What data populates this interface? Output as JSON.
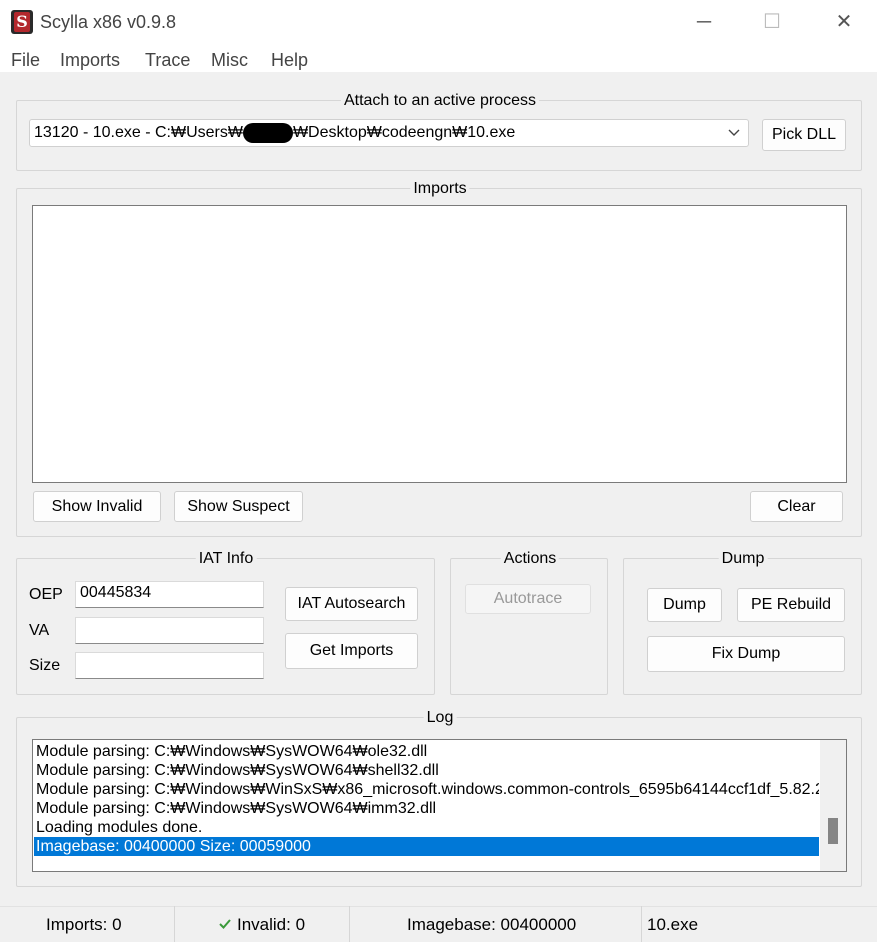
{
  "window": {
    "title": "Scylla x86 v0.9.8",
    "app_icon_letter": "S",
    "minimize_glyph": "─",
    "maximize_glyph": "☐",
    "close_glyph": "✕"
  },
  "menu": {
    "items": [
      {
        "label": "File"
      },
      {
        "label": "Imports"
      },
      {
        "label": "Trace"
      },
      {
        "label": "Misc"
      },
      {
        "label": "Help"
      }
    ]
  },
  "attach": {
    "group_title": "Attach to an active process",
    "process_prefix": "13120 - 10.exe - C:₩Users₩",
    "process_suffix": "₩Desktop₩codeengn₩10.exe",
    "pick_dll_label": "Pick DLL"
  },
  "imports": {
    "group_title": "Imports",
    "show_invalid_label": "Show Invalid",
    "show_suspect_label": "Show Suspect",
    "clear_label": "Clear"
  },
  "iat_info": {
    "group_title": "IAT Info",
    "oep_label": "OEP",
    "oep_value": "00445834",
    "va_label": "VA",
    "va_value": "",
    "size_label": "Size",
    "size_value": "",
    "iat_autosearch_label": "IAT Autosearch",
    "get_imports_label": "Get Imports"
  },
  "actions": {
    "group_title": "Actions",
    "autotrace_label": "Autotrace"
  },
  "dump": {
    "group_title": "Dump",
    "dump_label": "Dump",
    "pe_rebuild_label": "PE Rebuild",
    "fix_dump_label": "Fix Dump"
  },
  "log": {
    "group_title": "Log",
    "lines": [
      "Module parsing: C:₩Windows₩SysWOW64₩ole32.dll",
      "Module parsing: C:₩Windows₩SysWOW64₩shell32.dll",
      "Module parsing: C:₩Windows₩WinSxS₩x86_microsoft.windows.common-controls_6595b64144ccf1df_5.82.2",
      "Module parsing: C:₩Windows₩SysWOW64₩imm32.dll",
      "Loading modules done.",
      "Imagebase: 00400000 Size: 00059000"
    ]
  },
  "statusbar": {
    "imports": "Imports: 0",
    "invalid": "Invalid: 0",
    "imagebase": "Imagebase: 00400000",
    "module": "10.exe",
    "check_color": "#3a9a3a"
  }
}
